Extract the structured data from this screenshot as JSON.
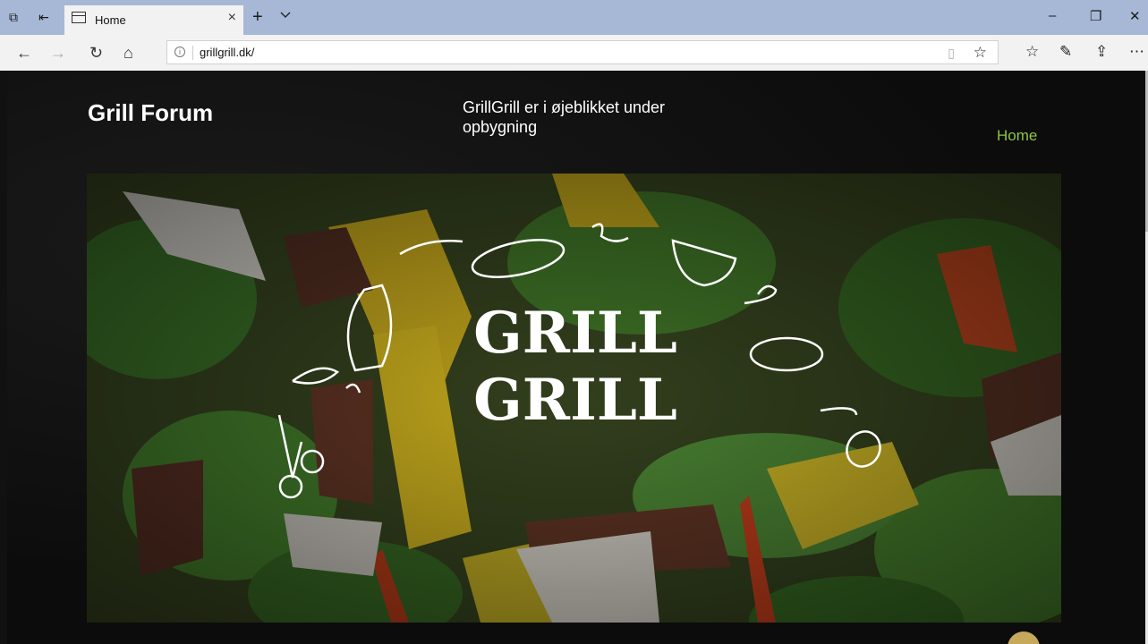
{
  "browser": {
    "tab_title": "Home",
    "url": "grillgrill.dk/",
    "nav_icons": [
      "back-icon",
      "forward-icon",
      "refresh-icon",
      "home-icon"
    ],
    "toolbar_icons": [
      "reading-view-icon",
      "favorite-star-icon",
      "favorites-hub-icon",
      "pen-icon",
      "share-icon",
      "more-icon"
    ]
  },
  "site": {
    "title": "Grill Forum",
    "tagline": "GrillGrill er i øjeblikket under opbygning",
    "nav": [
      {
        "label": "Home"
      }
    ],
    "hero_logo_line1": "GRILL",
    "hero_logo_line2": "GRILL"
  },
  "colors": {
    "titlebar": "#a6b8d6",
    "nav_link": "#8cc63f",
    "page_bg": "#0d0d0d"
  }
}
